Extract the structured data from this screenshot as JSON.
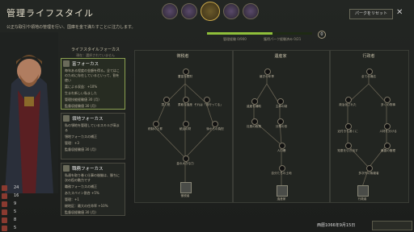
{
  "window": {
    "title": "管理ライフスタイル",
    "reset_label": "パークをリセット",
    "close_label": "✕",
    "description": "公正な取引や領地の管理を行い、国庫を金で満たすことに注力します。"
  },
  "tabs": [
    {
      "name": "diplomacy"
    },
    {
      "name": "martial"
    },
    {
      "name": "stewardship",
      "active": true
    },
    {
      "name": "intrigue"
    },
    {
      "name": "learning"
    }
  ],
  "focus": {
    "header": "ライフスタイルフォーカス",
    "sub": "現在：選択されていません",
    "cards": [
      {
        "title": "富フォーカス",
        "text": [
          "毎年ある程度の金額を得る。全てはこのために存在しているといって、割を使い",
          "富による収益：+10%",
          "生まれ新しい私ました",
          "管理技能経験値 30 (月)",
          "監督収経験値 30 (月)"
        ],
        "active": true
      },
      {
        "title": "領地フォーカス",
        "text": [
          "私の領地を管理しているスキルが高まる",
          "領地フォーカスの補正",
          "管理：+3",
          "監督収経験値 30 (月)"
        ]
      },
      {
        "title": "職務フォーカス",
        "text": [
          "私達を取り巻く仕事の後継は、勝ちに次の役の動力です",
          "職務フォーカスの補正",
          "あたスペイン割合 +5%",
          "管理：+1",
          "総地区：最大の任命率 +10%",
          "監督収経験値 30 (月)"
        ]
      }
    ]
  },
  "progress": {
    "fraction": 0.62,
    "label_left": "管理経験 0/900",
    "label_right": "獲得パーク経験済み 0/21",
    "perks_label": "0"
  },
  "trees": [
    {
      "title": "徴税者",
      "node_labels": [
        "豊富な蓄財",
        "賢く税",
        "柔軟な遺産",
        "それは「流行ってる」",
        "税制の上昇",
        "統治の財",
        "後からの負担",
        "金の大きな力"
      ],
      "box_label": "徴税者"
    },
    {
      "title": "遺産家",
      "node_labels": [
        "継ぎの年季",
        "遺産を補助",
        "主命の制",
        "社員の政策",
        "分業の形",
        "人口爆",
        "自分たちの土地"
      ],
      "box_label": "遺産家"
    },
    {
      "title": "行政者",
      "node_labels": [
        "全ての適応",
        "政治化された",
        "多くの物事",
        "近付きも遠くに",
        "人材を分ける",
        "知恵を引き出す",
        "最善の管理",
        "多次代の後継者"
      ],
      "box_label": "行政者"
    }
  ],
  "stats": [
    {
      "value": "24"
    },
    {
      "value": "16"
    },
    {
      "value": "9"
    },
    {
      "value": "5"
    },
    {
      "value": "8"
    },
    {
      "value": "5"
    }
  ],
  "date": "西暦1066年9月15日"
}
